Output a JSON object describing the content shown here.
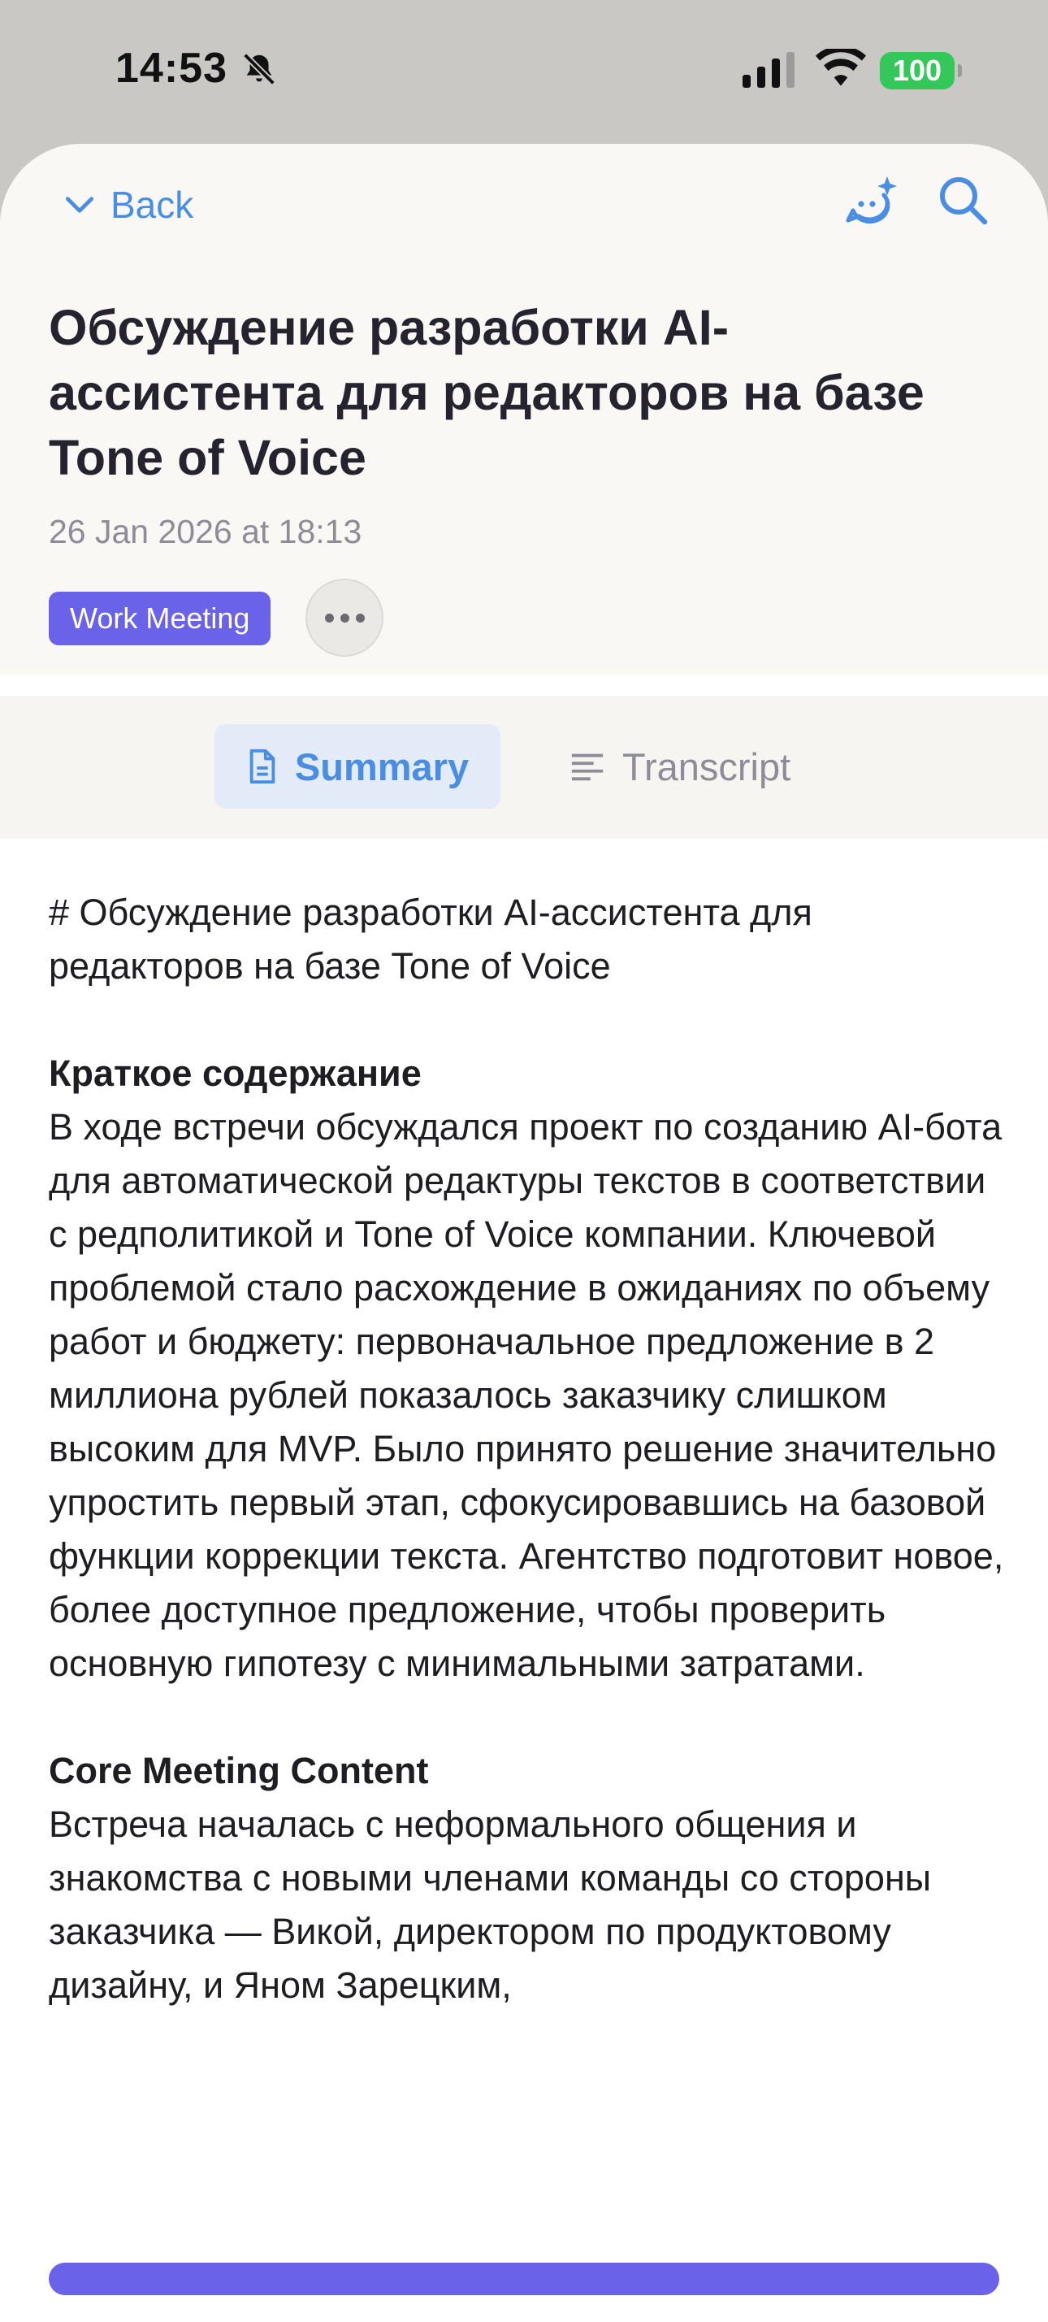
{
  "status_bar": {
    "time": "14:53",
    "battery": "100"
  },
  "nav": {
    "back_label": "Back"
  },
  "meeting": {
    "title": "Обсуждение разработки AI-ассистента для редакторов на базе Tone of Voice",
    "date": "26 Jan 2026 at 18:13",
    "tag": "Work Meeting"
  },
  "tabs": {
    "summary": "Summary",
    "transcript": "Transcript"
  },
  "content": {
    "h1": "# Обсуждение разработки AI-ассистента для редакторов на базе Tone of Voice",
    "summary_heading": "Краткое содержание",
    "summary_text": "В ходе встречи обсуждался проект по созданию AI-бота для автоматической редактуры текстов в соответствии с редполитикой и Tone of Voice компании. Ключевой проблемой стало расхождение в ожиданиях по объему работ и бюджету: первоначальное предложение в 2 миллиона рублей показалось заказчику слишком высоким для MVP. Было принято решение значительно упростить первый этап, сфокусировавшись на базовой функции коррекции текста. Агентство подготовит новое, более доступное предложение, чтобы проверить основную гипотезу с минимальными затратами.",
    "core_heading": "Core Meeting Content",
    "core_text": "Встреча началась с неформального общения и знакомства с новыми членами команды со стороны заказчика — Викой, директором по продуктовому дизайну, и Яном Зарецким,"
  },
  "colors": {
    "accent": "#4a8ee3",
    "tag": "#6a62e8",
    "battery": "#34c759"
  }
}
